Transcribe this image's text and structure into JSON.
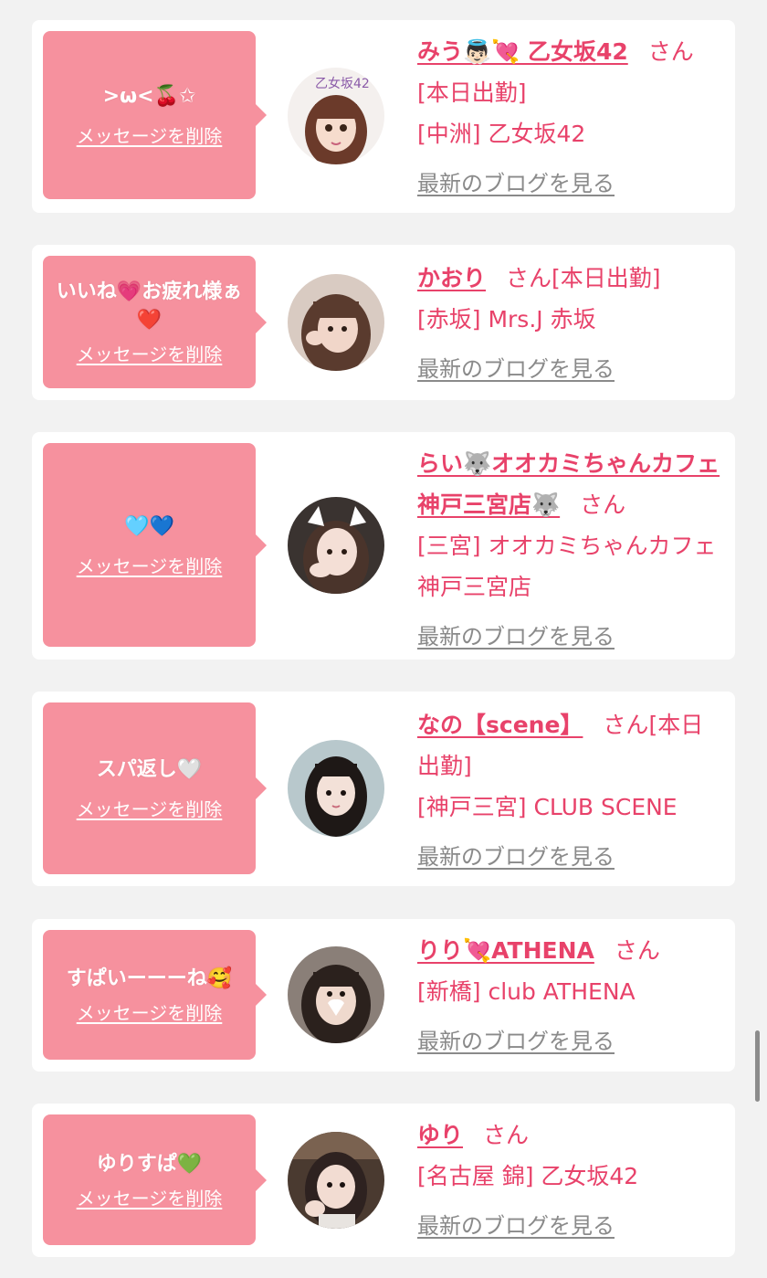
{
  "delete_label": "メッセージを削除",
  "blog_label": "最新のブログを見る",
  "san_label": "さん",
  "colors": {
    "bubble": "#f6919e",
    "accent": "#e8426a",
    "link_gray": "#8a8a8a",
    "background": "#f2f2f2"
  },
  "cards": [
    {
      "message": ">ω<🍒✩",
      "name": "みう👼🏻💘 乙女坂42",
      "status": "[本日出勤]",
      "location": "[中洲] 乙女坂42",
      "avatar_badge": "乙女坂42"
    },
    {
      "message": "いいね💗お疲れ様ぁ❤️",
      "name": "かおり",
      "status": "[本日出勤]",
      "location": "[赤坂] Mrs.J 赤坂"
    },
    {
      "message": "🩵💙",
      "name": "らい🐺オオカミちゃんカフェ神戸三宮店🐺",
      "status": "",
      "location": "[三宮] オオカミちゃんカフェ神戸三宮店"
    },
    {
      "message": "スパ返し🤍",
      "name": "なの【scene】",
      "status": "[本日出勤]",
      "location": "[神戸三宮] CLUB SCENE"
    },
    {
      "message": "すぱいーーーね🥰",
      "name": "りり💘ATHENA",
      "status": "",
      "location": "[新橋] club ATHENA"
    },
    {
      "message": "ゆりすぱ💚",
      "name": "ゆり",
      "status": "",
      "location": "[名古屋 錦] 乙女坂42"
    }
  ]
}
